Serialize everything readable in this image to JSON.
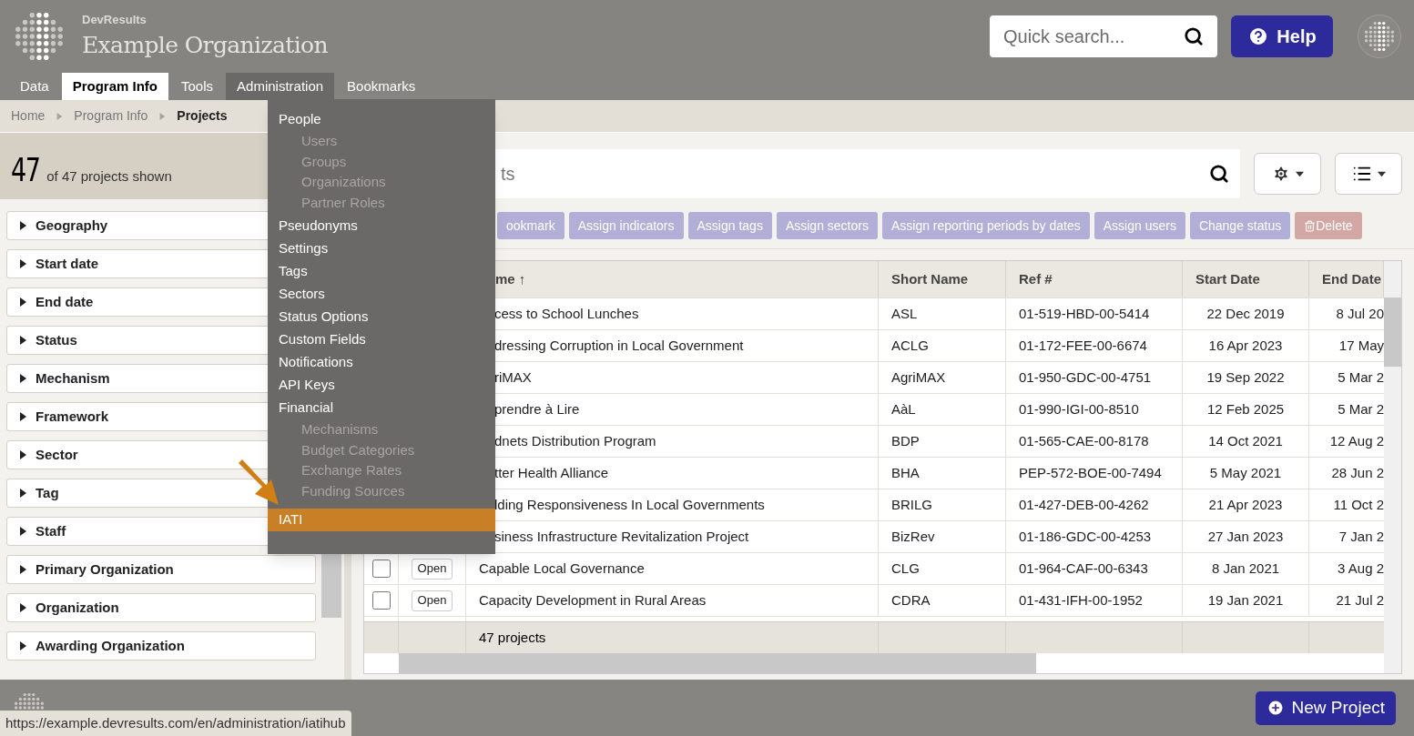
{
  "brand": {
    "product": "DevResults",
    "organization": "Example Organization"
  },
  "quick_search": {
    "placeholder": "Quick search..."
  },
  "help_button": "Help",
  "nav": [
    {
      "label": "Data",
      "selected": false,
      "expanded": false
    },
    {
      "label": "Program Info",
      "selected": true,
      "expanded": false
    },
    {
      "label": "Tools",
      "selected": false,
      "expanded": false
    },
    {
      "label": "Administration",
      "selected": false,
      "expanded": true
    },
    {
      "label": "Bookmarks",
      "selected": false,
      "expanded": false
    }
  ],
  "breadcrumb": [
    "Home",
    "Program Info",
    "Projects"
  ],
  "count": {
    "number": "47",
    "text": "of 47 projects shown"
  },
  "filters": [
    "Geography",
    "Start date",
    "End date",
    "Status",
    "Mechanism",
    "Framework",
    "Sector",
    "Tag",
    "Staff",
    "Primary Organization",
    "Organization",
    "Awarding Organization"
  ],
  "project_search": {
    "placeholder": "ts"
  },
  "actions": [
    {
      "label": "ookmark",
      "kind": "normal"
    },
    {
      "label": "Assign indicators",
      "kind": "normal"
    },
    {
      "label": "Assign tags",
      "kind": "normal"
    },
    {
      "label": "Assign sectors",
      "kind": "normal"
    },
    {
      "label": "Assign reporting periods by dates",
      "kind": "normal"
    },
    {
      "label": "Assign users",
      "kind": "normal"
    },
    {
      "label": "Change status",
      "kind": "normal"
    },
    {
      "label": "Delete",
      "kind": "danger"
    }
  ],
  "table": {
    "columns": [
      "me ↑",
      "Short Name",
      "Ref #",
      "Start Date",
      "End Date"
    ],
    "rows": [
      {
        "name": "cess to School Lunches",
        "short": "ASL",
        "ref": "01-519-HBD-00-5414",
        "start": "22 Dec 2019",
        "end": "8 Jul 20"
      },
      {
        "name": "dressing Corruption in Local Government",
        "short": "ACLG",
        "ref": "01-172-FEE-00-6674",
        "start": "16 Apr 2023",
        "end": "17 May"
      },
      {
        "name": "riMAX",
        "short": "AgriMAX",
        "ref": "01-950-GDC-00-4751",
        "start": "19 Sep 2022",
        "end": "5 Mar 2"
      },
      {
        "name": "prendre à Lire",
        "short": "AàL",
        "ref": "01-990-IGI-00-8510",
        "start": "12 Feb 2025",
        "end": "5 Mar 2"
      },
      {
        "name": "dnets Distribution Program",
        "short": "BDP",
        "ref": "01-565-CAE-00-8178",
        "start": "14 Oct 2021",
        "end": "12 Aug 2"
      },
      {
        "name": "tter Health Alliance",
        "short": "BHA",
        "ref": "PEP-572-BOE-00-7494",
        "start": "5 May 2021",
        "end": "28 Jun 2"
      },
      {
        "name": "lding Responsiveness In Local Governments",
        "short": "BRILG",
        "ref": "01-427-DEB-00-4262",
        "start": "21 Apr 2023",
        "end": "11 Oct 2"
      },
      {
        "name": "siness Infrastructure Revitalization Project",
        "short": "BizRev",
        "ref": "01-186-GDC-00-4253",
        "start": "27 Jan 2023",
        "end": "7 Jan 2"
      },
      {
        "checked": false,
        "open": "Open",
        "name": "Capable Local Governance",
        "short": "CLG",
        "ref": "01-964-CAF-00-6343",
        "start": "8 Jan 2021",
        "end": "3 Aug 2"
      },
      {
        "checked": false,
        "open": "Open",
        "name": "Capacity Development in Rural Areas",
        "short": "CDRA",
        "ref": "01-431-IFH-00-1952",
        "start": "19 Jan 2021",
        "end": "21 Jul 2"
      }
    ],
    "footer": "47 projects"
  },
  "admin_menu": [
    {
      "label": "People",
      "selected": false,
      "children": [
        "Users",
        "Groups",
        "Organizations",
        "Partner Roles"
      ]
    },
    {
      "label": "Pseudonyms",
      "selected": false
    },
    {
      "label": "Settings",
      "selected": false
    },
    {
      "label": "Tags",
      "selected": false
    },
    {
      "label": "Sectors",
      "selected": false
    },
    {
      "label": "Status Options",
      "selected": false
    },
    {
      "label": "Custom Fields",
      "selected": false
    },
    {
      "label": "Notifications",
      "selected": false
    },
    {
      "label": "API Keys",
      "selected": false
    },
    {
      "label": "Financial",
      "selected": false,
      "children": [
        "Mechanisms",
        "Budget Categories",
        "Exchange Rates",
        "Funding Sources"
      ]
    },
    {
      "label": "IATI",
      "selected": true
    }
  ],
  "status_url": "https://example.devresults.com/en/administration/iatihub",
  "new_project_button": "New Project"
}
